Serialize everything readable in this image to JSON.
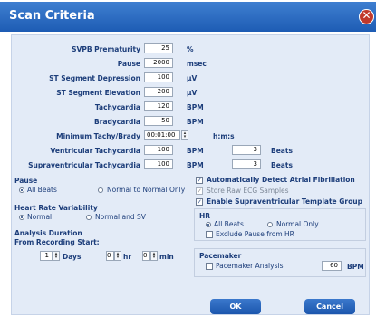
{
  "window": {
    "title": "Scan Criteria",
    "close_icon": "close-icon",
    "close_glyph": "✕"
  },
  "rows": [
    {
      "label": "SVPB Prematurity",
      "value": "25",
      "unit": "%"
    },
    {
      "label": "Pause",
      "value": "2000",
      "unit": "msec"
    },
    {
      "label": "ST Segment Depression",
      "value": "100",
      "unit": "µV"
    },
    {
      "label": "ST Segment Elevation",
      "value": "200",
      "unit": "µV"
    },
    {
      "label": "Tachycardia",
      "value": "120",
      "unit": "BPM"
    },
    {
      "label": "Bradycardia",
      "value": "50",
      "unit": "BPM"
    },
    {
      "label": "Minimum Tachy/Brady",
      "value": "00:01:00",
      "unit": "h:m:s"
    },
    {
      "label": "Ventricular Tachycardia",
      "value": "100",
      "unit": "BPM",
      "value2": "3",
      "unit2": "Beats"
    },
    {
      "label": "Supraventricular Tachycardia",
      "value": "100",
      "unit": "BPM",
      "value2": "3",
      "unit2": "Beats"
    }
  ],
  "pause_group": {
    "label": "Pause",
    "options": [
      "All Beats",
      "Normal to Normal Only"
    ],
    "selected": "All Beats"
  },
  "hrv_group": {
    "label": "Heart Rate Variability",
    "options": [
      "Normal",
      "Normal and SV"
    ],
    "selected": "Normal"
  },
  "analysis": {
    "label1": "Analysis Duration",
    "label2": "From Recording Start:",
    "days_value": "1",
    "days_label": "Days",
    "hr_value": "0",
    "hr_label": "hr",
    "min_value": "0",
    "min_label": "min"
  },
  "checks": [
    {
      "label": "Automatically Detect Atrial Fibrillation",
      "checked": true,
      "disabled": false
    },
    {
      "label": "Store Raw ECG Samples",
      "checked": true,
      "disabled": true
    },
    {
      "label": "Enable Supraventricular Template Group",
      "checked": true,
      "disabled": false
    }
  ],
  "hr_group": {
    "label": "HR",
    "options": [
      "All Beats",
      "Normal Only"
    ],
    "selected": "All Beats",
    "exclude_label": "Exclude Pause from HR"
  },
  "pacemaker": {
    "label": "Pacemaker",
    "analysis_label": "Pacemaker Analysis",
    "value": "60",
    "unit": "BPM"
  },
  "buttons": {
    "ok": "OK",
    "cancel": "Cancel"
  },
  "colors": {
    "title_bar": "#2563c0",
    "panel": "#e3ebf7",
    "text": "#1c3d7a",
    "button": "#2a66bd"
  }
}
